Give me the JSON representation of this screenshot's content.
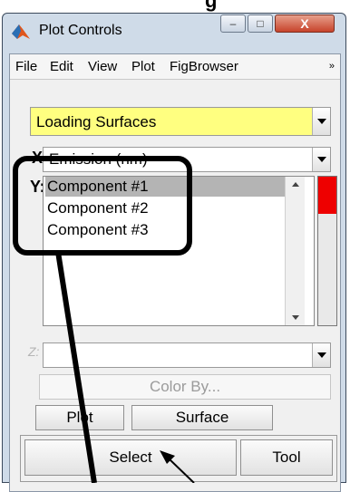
{
  "caption_fragment": "g",
  "window": {
    "title": "Plot Controls",
    "controls": {
      "minimize": "–",
      "maximize": "□",
      "close": "X"
    }
  },
  "menu": [
    "File",
    "Edit",
    "View",
    "Plot",
    "FigBrowser"
  ],
  "menu_overflow": "»",
  "mode_select": {
    "value": "Loading Surfaces",
    "color": "#ffff80"
  },
  "x_axis": {
    "label": "X",
    "value": "Emission (nm)"
  },
  "y_axis": {
    "label": "Y:",
    "items": [
      "Component #1",
      "Component #2",
      "Component #3"
    ],
    "selected_index": 0
  },
  "z_axis": {
    "label": "Z:",
    "value": ""
  },
  "color_by_label": "Color By...",
  "buttons": {
    "plot": "Plot",
    "surface": "Surface",
    "select": "Select",
    "tool": "Tool"
  },
  "slider": {
    "fill_fraction": 0.25,
    "fill_color": "#ee0000"
  },
  "annotation": {
    "color": "#000000"
  }
}
